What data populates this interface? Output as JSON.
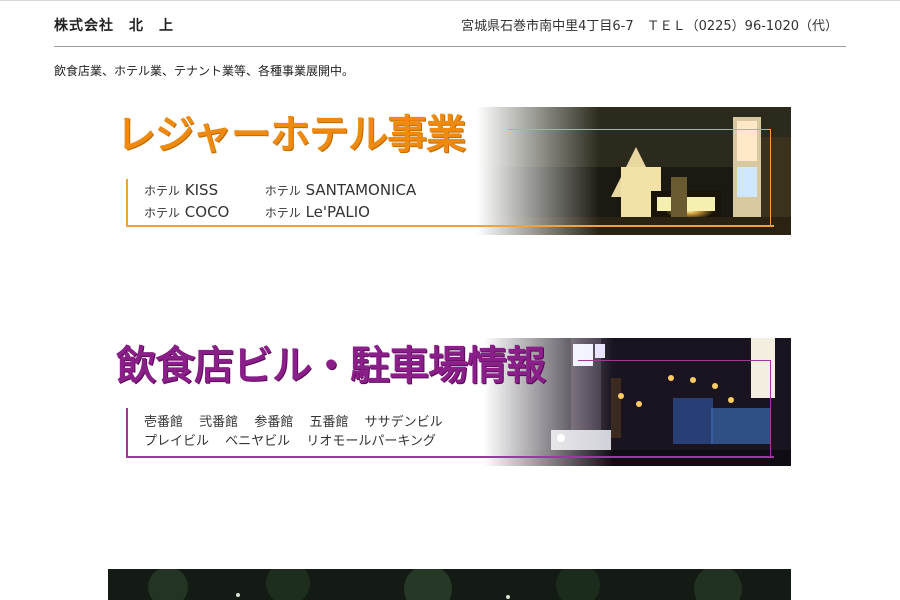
{
  "header": {
    "company": "株式会社　北　上",
    "contact": "宮城県石巻市南中里4丁目6-7　ＴＥＬ（0225）96-1020（代）"
  },
  "intro": "飲食店業、ホテル業、テナント業等、各種事業展開中。",
  "banners": [
    {
      "title": "レジャーホテル事業",
      "rows": [
        [
          {
            "prefix": "ホテル",
            "name": "KISS"
          },
          {
            "prefix": "ホテル",
            "name": "SANTAMONICA"
          }
        ],
        [
          {
            "prefix": "ホテル",
            "name": "COCO"
          },
          {
            "prefix": "ホテル",
            "name": "Le'PALIO"
          }
        ]
      ],
      "accent": "#ee8a10"
    },
    {
      "title": "飲食店ビル・駐車場情報",
      "rows": [
        [
          "壱番館",
          "弐番館",
          "参番館",
          "五番館",
          "ササデンビル"
        ],
        [
          "プレイビル",
          "ベニヤビル",
          "リオモールパーキング"
        ]
      ],
      "accent": "#8a1f8a"
    }
  ]
}
